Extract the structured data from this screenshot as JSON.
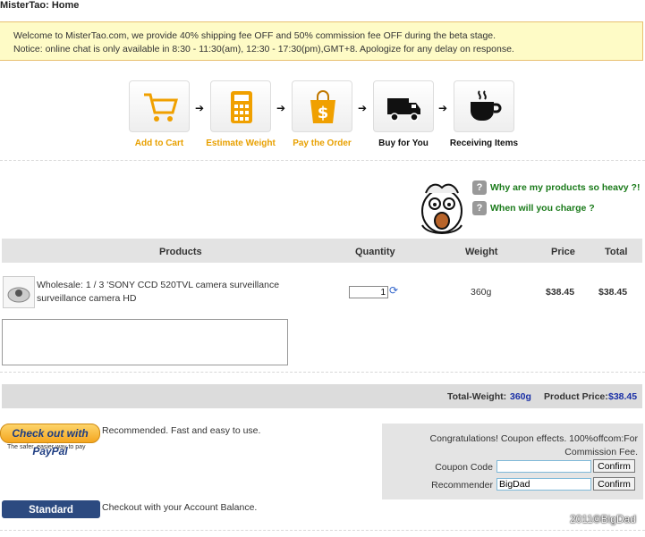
{
  "breadcrumb": "MisterTao: Home",
  "notice": {
    "line1": "Welcome to MisterTao.com, we provide 40% shipping fee OFF and 50% commission fee OFF during the beta stage.",
    "line2": "Notice: online chat is only available in 8:30 - 11:30(am), 12:30 - 17:30(pm),GMT+8. Apologize for any delay on response."
  },
  "steps": [
    {
      "label": "Add to Cart",
      "icon": "cart-icon",
      "color": "#e8a000"
    },
    {
      "label": "Estimate Weight",
      "icon": "calculator-icon",
      "color": "#e8a000"
    },
    {
      "label": "Pay the Order",
      "icon": "shopping-bag-icon",
      "color": "#e8a000"
    },
    {
      "label": "Buy for You",
      "icon": "truck-icon",
      "color": "#111111"
    },
    {
      "label": "Receiving Items",
      "icon": "coffee-cup-icon",
      "color": "#111111"
    }
  ],
  "faq": {
    "q1": "Why are my products so heavy ?!",
    "q2": "When will you charge ?"
  },
  "table": {
    "headers": {
      "products": "Products",
      "quantity": "Quantity",
      "weight": "Weight",
      "price": "Price",
      "total": "Total"
    },
    "row": {
      "name": "Wholesale: 1 / 3 'SONY CCD 520TVL camera surveillance surveillance camera HD",
      "quantity": "1",
      "weight": "360g",
      "price": "$38.45",
      "total": "$38.45"
    }
  },
  "totals": {
    "weight_label": "Total-Weight:",
    "weight_value": "360g",
    "price_label": "Product Price:",
    "price_value": "$38.45"
  },
  "paypal": {
    "button": "Check out with PayPal",
    "tagline": "The safer, easier way to pay",
    "note": "Recommended. Fast and easy to use."
  },
  "coupon": {
    "message": "Congratulations! Coupon effects. 100%offcom:For Commission Fee.",
    "coupon_label": "Coupon Code",
    "coupon_value": "",
    "recommender_label": "Recommender",
    "recommender_value": "BigDad",
    "confirm": "Confirm"
  },
  "standard": {
    "button": "Standard Checkout",
    "note": "Checkout with your Account Balance."
  },
  "watermark": "2011©BigDad",
  "colors": {
    "notice_bg": "#fefbc6",
    "notice_border": "#e8c070",
    "faq_green": "#1a7a1a",
    "total_blue": "#1a2fa6",
    "step_orange": "#e8a000"
  }
}
